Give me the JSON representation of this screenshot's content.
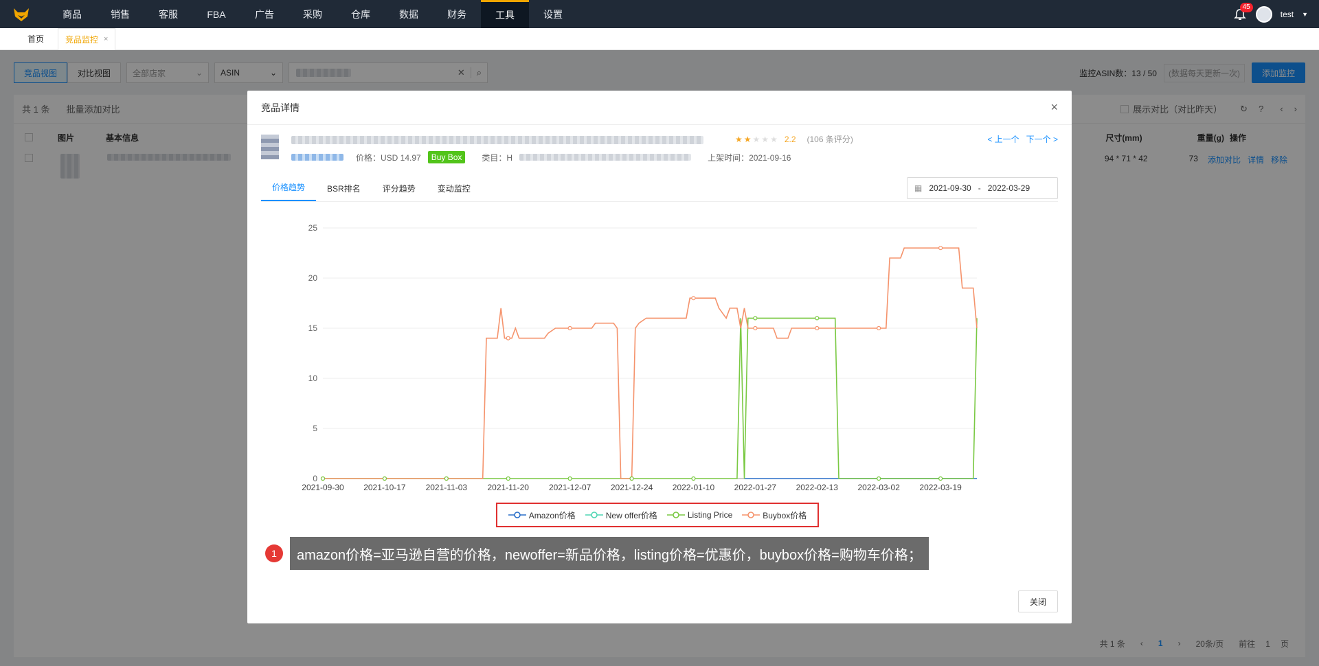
{
  "nav": {
    "items": [
      "商品",
      "销售",
      "客服",
      "FBA",
      "广告",
      "采购",
      "仓库",
      "数据",
      "财务",
      "工具",
      "设置"
    ],
    "active": "工具",
    "notification_count": "45",
    "user": "test"
  },
  "tabs": [
    {
      "label": "首页"
    },
    {
      "label": "竞品监控",
      "close": "×"
    }
  ],
  "toolbar": {
    "view_compete": "竞品视图",
    "view_compare": "对比视图",
    "store_select": "全部店家",
    "asin_select": "ASIN",
    "monitor_label": "监控ASIN数：13 / 50",
    "update_hint": "(数据每天更新一次)",
    "add_button": "添加监控"
  },
  "table": {
    "total": "共 1 条",
    "batch": "批量添加对比",
    "show_compare": "展示对比（对比昨天）",
    "headers": {
      "image": "图片",
      "info": "基本信息",
      "size": "尺寸(mm)",
      "weight": "重量(g)",
      "ops": "操作"
    },
    "row": {
      "size": "94 * 71 * 42",
      "weight": "73",
      "op_add": "添加对比",
      "op_detail": "详情",
      "op_remove": "移除"
    }
  },
  "modal": {
    "title": "竞品详情",
    "close_x": "×",
    "rating": "2.2",
    "reviews": "(106 条评分)",
    "prev": "< 上一个",
    "next": "下一个 >",
    "price": "价格：USD 14.97",
    "buybox": "Buy Box",
    "category": "类目：H",
    "listing_date": "上架时间：2021-09-16",
    "chart_tabs": [
      "价格趋势",
      "BSR排名",
      "评分趋势",
      "变动监控"
    ],
    "date_start": "2021-09-30",
    "date_sep": "-",
    "date_end": "2022-03-29",
    "close_button": "关闭"
  },
  "annotation": {
    "number": "1",
    "text": "amazon价格=亚马逊自营的价格，newoffer=新品价格，listing价格=优惠价，buybox价格=购物车价格；"
  },
  "pagination": {
    "total": "共 1 条",
    "prev": "‹",
    "current": "1",
    "next": "›",
    "per_page": "20条/页",
    "goto": "前往",
    "goto_page": "1",
    "page_unit": "页"
  },
  "colors": {
    "amazon": "#2a6fc9",
    "newoffer": "#4fd6b3",
    "listing": "#7ac943",
    "buybox": "#f5936c"
  },
  "chart_data": {
    "type": "line",
    "x_ticks": [
      "2021-09-30",
      "2021-10-17",
      "2021-11-03",
      "2021-11-20",
      "2021-12-07",
      "2021-12-24",
      "2022-01-10",
      "2022-01-27",
      "2022-02-13",
      "2022-03-02",
      "2022-03-19"
    ],
    "x_range": [
      "2021-09-30",
      "2022-03-29"
    ],
    "ylim": [
      0,
      25
    ],
    "y_ticks": [
      0,
      5,
      10,
      15,
      20,
      25
    ],
    "grid": true,
    "legend": "bottom",
    "series": [
      {
        "name": "Amazon价格",
        "color_key": "amazon",
        "points": [
          [
            "2022-01-24",
            0
          ],
          [
            "2022-03-29",
            0
          ]
        ]
      },
      {
        "name": "New offer价格",
        "color_key": "newoffer",
        "points": []
      },
      {
        "name": "Listing Price",
        "color_key": "listing",
        "points": [
          [
            "2021-09-30",
            0
          ],
          [
            "2022-01-22",
            0
          ],
          [
            "2022-01-23",
            16
          ],
          [
            "2022-01-24",
            0
          ],
          [
            "2022-01-25",
            16
          ],
          [
            "2022-02-18",
            16
          ],
          [
            "2022-02-19",
            0
          ],
          [
            "2022-03-28",
            0
          ],
          [
            "2022-03-29",
            16
          ]
        ]
      },
      {
        "name": "Buybox价格",
        "color_key": "buybox",
        "points": [
          [
            "2021-09-30",
            0
          ],
          [
            "2021-11-13",
            0
          ],
          [
            "2021-11-14",
            14
          ],
          [
            "2021-11-17",
            14
          ],
          [
            "2021-11-18",
            17
          ],
          [
            "2021-11-19",
            14
          ],
          [
            "2021-11-21",
            14
          ],
          [
            "2021-11-22",
            15
          ],
          [
            "2021-11-23",
            14
          ],
          [
            "2021-11-30",
            14
          ],
          [
            "2021-12-01",
            14.5
          ],
          [
            "2021-12-03",
            15
          ],
          [
            "2021-12-13",
            15
          ],
          [
            "2021-12-14",
            15.5
          ],
          [
            "2021-12-19",
            15.5
          ],
          [
            "2021-12-20",
            15
          ],
          [
            "2021-12-21",
            0
          ],
          [
            "2021-12-24",
            0
          ],
          [
            "2021-12-25",
            15
          ],
          [
            "2021-12-26",
            15.5
          ],
          [
            "2021-12-28",
            16
          ],
          [
            "2022-01-08",
            16
          ],
          [
            "2022-01-09",
            18
          ],
          [
            "2022-01-16",
            18
          ],
          [
            "2022-01-17",
            17
          ],
          [
            "2022-01-19",
            16
          ],
          [
            "2022-01-20",
            17
          ],
          [
            "2022-01-22",
            17
          ],
          [
            "2022-01-23",
            15
          ],
          [
            "2022-01-24",
            17
          ],
          [
            "2022-01-25",
            15
          ],
          [
            "2022-02-01",
            15
          ],
          [
            "2022-02-02",
            14
          ],
          [
            "2022-02-05",
            14
          ],
          [
            "2022-02-06",
            15
          ],
          [
            "2022-03-04",
            15
          ],
          [
            "2022-03-05",
            22
          ],
          [
            "2022-03-08",
            22
          ],
          [
            "2022-03-09",
            23
          ],
          [
            "2022-03-24",
            23
          ],
          [
            "2022-03-25",
            19
          ],
          [
            "2022-03-28",
            19
          ],
          [
            "2022-03-29",
            15
          ]
        ]
      }
    ]
  }
}
